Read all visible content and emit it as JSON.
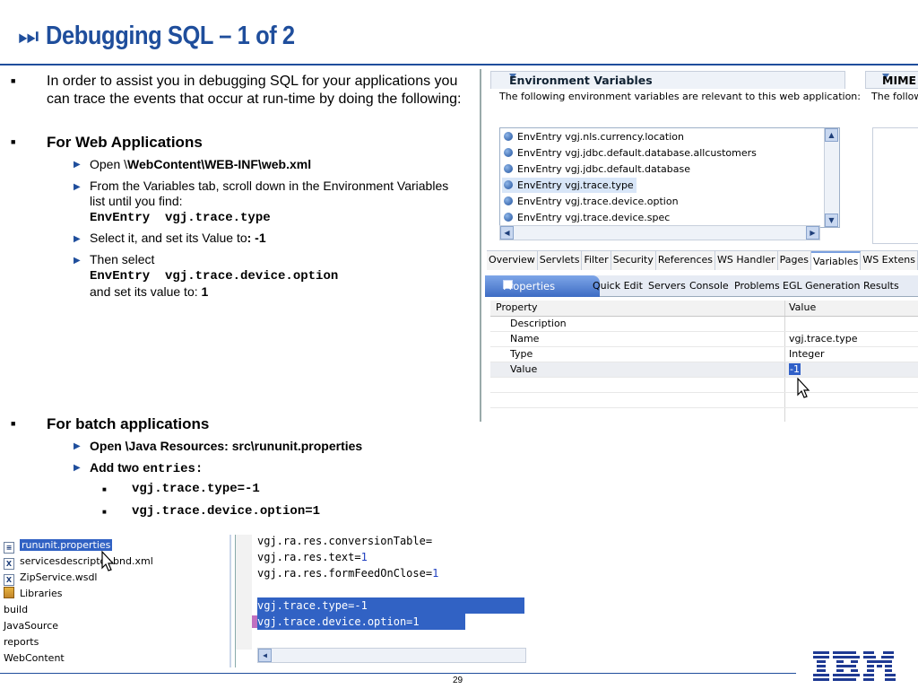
{
  "slide": {
    "title": "Debugging SQL – 1 of 2",
    "page_number": "29"
  },
  "content": {
    "intro": "In order to assist you in debugging SQL for your applications you can trace the events that occur at run-time by doing the following:",
    "web_heading": "For Web Applications",
    "web_open_prefix": "Open \\",
    "web_open_path": "WebContent\\WEB-INF\\web.xml",
    "web_step2": "From the Variables tab, scroll down in the Environment Variables list until you find:",
    "web_step2_code": "EnvEntry  vgj.trace.type",
    "web_step3_prefix": "Select it, and set its Value to",
    "web_step3_value": ": -1",
    "web_step4_prefix": "Then select",
    "web_step4_code": "EnvEntry  vgj.trace.device.option",
    "web_step4_suffix": "and set its value to: ",
    "web_step4_value": "1",
    "batch_heading": "For batch applications",
    "batch_step1": "Open \\Java Resources: src\\rununit.properties",
    "batch_step2_prefix": "Add two ",
    "batch_step2_code": "entries:",
    "batch_entries": [
      "vgj.trace.type=-1",
      "vgj.trace.device.option=1"
    ]
  },
  "eclipse": {
    "env_section_title": "Environment Variables",
    "env_section_desc": "The following environment variables are relevant to this web application:",
    "mime_section_title": "MIME",
    "mime_section_desc": "The followi",
    "env_entries": [
      "EnvEntry vgj.nls.currency.location",
      "EnvEntry vgj.jdbc.default.database.allcustomers",
      "EnvEntry vgj.jdbc.default.database",
      "EnvEntry vgj.trace.type",
      "EnvEntry vgj.trace.device.option",
      "EnvEntry vgj.trace.device.spec"
    ],
    "editor_tabs": [
      "Overview",
      "Servlets",
      "Filter",
      "Security",
      "References",
      "WS Handler",
      "Pages",
      "Variables",
      "WS Extens"
    ],
    "view_tabs": [
      "Properties",
      "Quick Edit",
      "Servers",
      "Console",
      "Problems",
      "EGL Generation Results"
    ],
    "props_header": [
      "Property",
      "Value"
    ],
    "props_rows": [
      {
        "property": "Description",
        "value": ""
      },
      {
        "property": "Name",
        "value": "vgj.trace.type"
      },
      {
        "property": "Type",
        "value": "Integer"
      },
      {
        "property": "Value",
        "value": "-1"
      }
    ]
  },
  "explorer": {
    "items": [
      "rununit.properties",
      "servicesdescriptor-bnd.xml",
      "ZipService.wsdl",
      "Libraries",
      "build",
      "JavaSource",
      "reports",
      "WebContent"
    ]
  },
  "editor": {
    "lines": [
      {
        "key": "vgj.ra.res.conversionTable=",
        "val": ""
      },
      {
        "key": "vgj.ra.res.text=",
        "val": "1"
      },
      {
        "key": "vgj.ra.res.formFeedOnClose=",
        "val": "1"
      },
      {
        "key": "",
        "val": ""
      },
      {
        "key": "vgj.trace.type=-1",
        "val": ""
      },
      {
        "key": "vgj.trace.device.option=1",
        "val": ""
      }
    ]
  },
  "colors": {
    "accent": "#1f4e9c",
    "selection": "#3162c4"
  }
}
